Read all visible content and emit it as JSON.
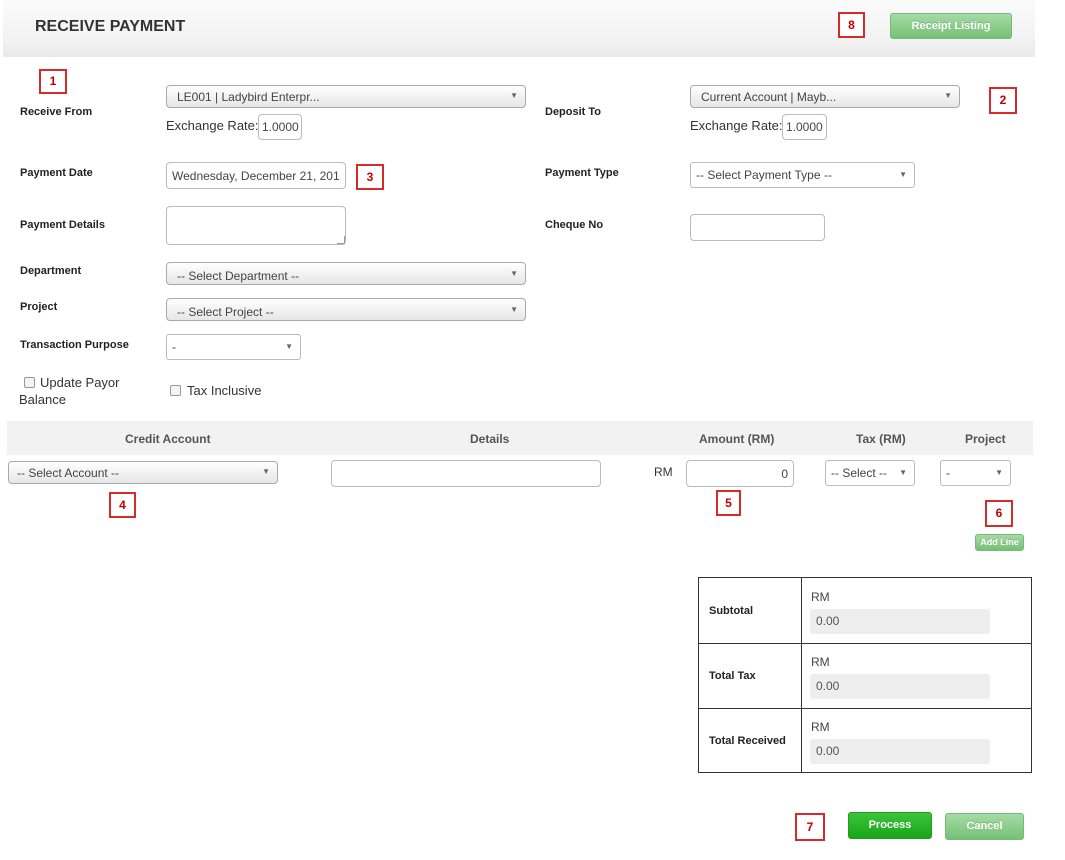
{
  "header": {
    "title": "RECEIVE PAYMENT",
    "receipt_listing_label": "Receipt Listing"
  },
  "markers": [
    "1",
    "2",
    "3",
    "4",
    "5",
    "6",
    "7",
    "8"
  ],
  "form": {
    "receive_from": {
      "label": "Receive From",
      "value": "LE001 | Ladybird Enterpr...",
      "exchange_label": "Exchange Rate:",
      "exchange_value": "1.0000"
    },
    "deposit_to": {
      "label": "Deposit To",
      "value": "Current Account | Mayb...",
      "exchange_label": "Exchange Rate:",
      "exchange_value": "1.0000"
    },
    "payment_date": {
      "label": "Payment Date",
      "value": "Wednesday, December 21, 201"
    },
    "payment_type": {
      "label": "Payment Type",
      "value": "-- Select Payment Type --"
    },
    "payment_details": {
      "label": "Payment Details",
      "value": ""
    },
    "cheque_no": {
      "label": "Cheque No",
      "value": ""
    },
    "department": {
      "label": "Department",
      "value": "-- Select Department --"
    },
    "project": {
      "label": "Project",
      "value": "-- Select Project --"
    },
    "transaction_purpose": {
      "label": "Transaction Purpose",
      "value": "-"
    },
    "update_payor": {
      "label_line1": "Update Payor",
      "label_line2": "Balance"
    },
    "tax_inclusive": {
      "label": "Tax Inclusive"
    }
  },
  "lines": {
    "columns": {
      "credit_account": "Credit Account",
      "details": "Details",
      "amount": "Amount (RM)",
      "tax": "Tax (RM)",
      "project": "Project"
    },
    "row": {
      "account": "-- Select Account --",
      "details": "",
      "currency": "RM",
      "amount": "0",
      "tax": "-- Select --",
      "project": "-"
    },
    "add_line_label": "Add Line"
  },
  "totals": {
    "subtotal": {
      "label": "Subtotal",
      "currency": "RM",
      "value": "0.00"
    },
    "total_tax": {
      "label": "Total Tax",
      "currency": "RM",
      "value": "0.00"
    },
    "total_received": {
      "label": "Total Received",
      "currency": "RM",
      "value": "0.00"
    }
  },
  "actions": {
    "process_label": "Process",
    "cancel_label": "Cancel"
  }
}
